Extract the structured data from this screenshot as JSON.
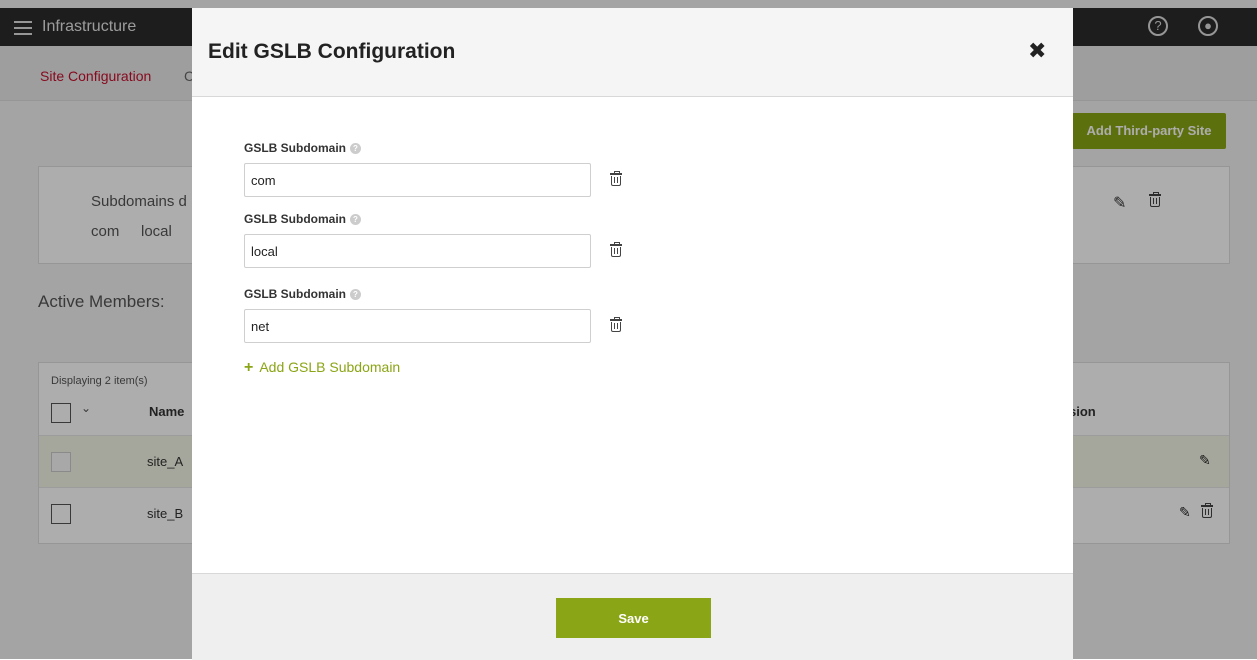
{
  "app": {
    "title": "Infrastructure",
    "tabs": [
      "Site Configuration",
      "C"
    ],
    "add_site_label": "Add Third-party Site",
    "subdomains_desc": "Subdomains d",
    "subdomain_chips": [
      "com",
      "local"
    ],
    "active_members_title": "Active Members:",
    "table": {
      "count_text": "Displaying 2 item(s)",
      "col_name": "Name",
      "col_version": "sion",
      "rows": [
        {
          "name": "site_A"
        },
        {
          "name": "site_B"
        }
      ]
    }
  },
  "modal": {
    "title": "Edit GSLB Configuration",
    "fields": [
      {
        "label": "GSLB Subdomain",
        "value": "com"
      },
      {
        "label": "GSLB Subdomain",
        "value": "local"
      },
      {
        "label": "GSLB Subdomain",
        "value": "net"
      }
    ],
    "add_label": "Add GSLB Subdomain",
    "save_label": "Save"
  },
  "colors": {
    "accent": "#8aa515",
    "active_tab": "#c8102e",
    "topbar": "#2b2b2b"
  },
  "icons": [
    "menu-icon",
    "help-icon",
    "user-icon",
    "close-icon",
    "trash-icon",
    "edit-icon",
    "plus-icon",
    "chevron-down-icon"
  ]
}
